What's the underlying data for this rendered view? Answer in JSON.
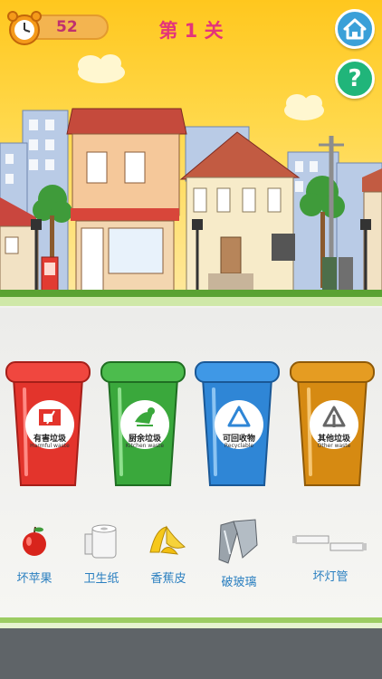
{
  "hud": {
    "timer_value": "52",
    "level_title": "第 1 关"
  },
  "bins": [
    {
      "name_cn": "有害垃圾",
      "name_en": "Harmful waste",
      "color": "#e3342c"
    },
    {
      "name_cn": "厨余垃圾",
      "name_en": "Kitchen waste",
      "color": "#3aa83c"
    },
    {
      "name_cn": "可回收物",
      "name_en": "Recyclable",
      "color": "#2f86d6"
    },
    {
      "name_cn": "其他垃圾",
      "name_en": "Other waste",
      "color": "#d68a12"
    }
  ],
  "items": [
    {
      "label": "坏苹果",
      "icon": "rotten-apple-icon"
    },
    {
      "label": "卫生纸",
      "icon": "toilet-paper-icon"
    },
    {
      "label": "香蕉皮",
      "icon": "banana-peel-icon"
    },
    {
      "label": "破玻璃",
      "icon": "broken-glass-icon"
    },
    {
      "label": "坏灯管",
      "icon": "broken-tube-lamp-icon"
    }
  ],
  "icons": {
    "timer": "alarm-clock-icon",
    "home": "home-icon",
    "help": "help-icon"
  }
}
